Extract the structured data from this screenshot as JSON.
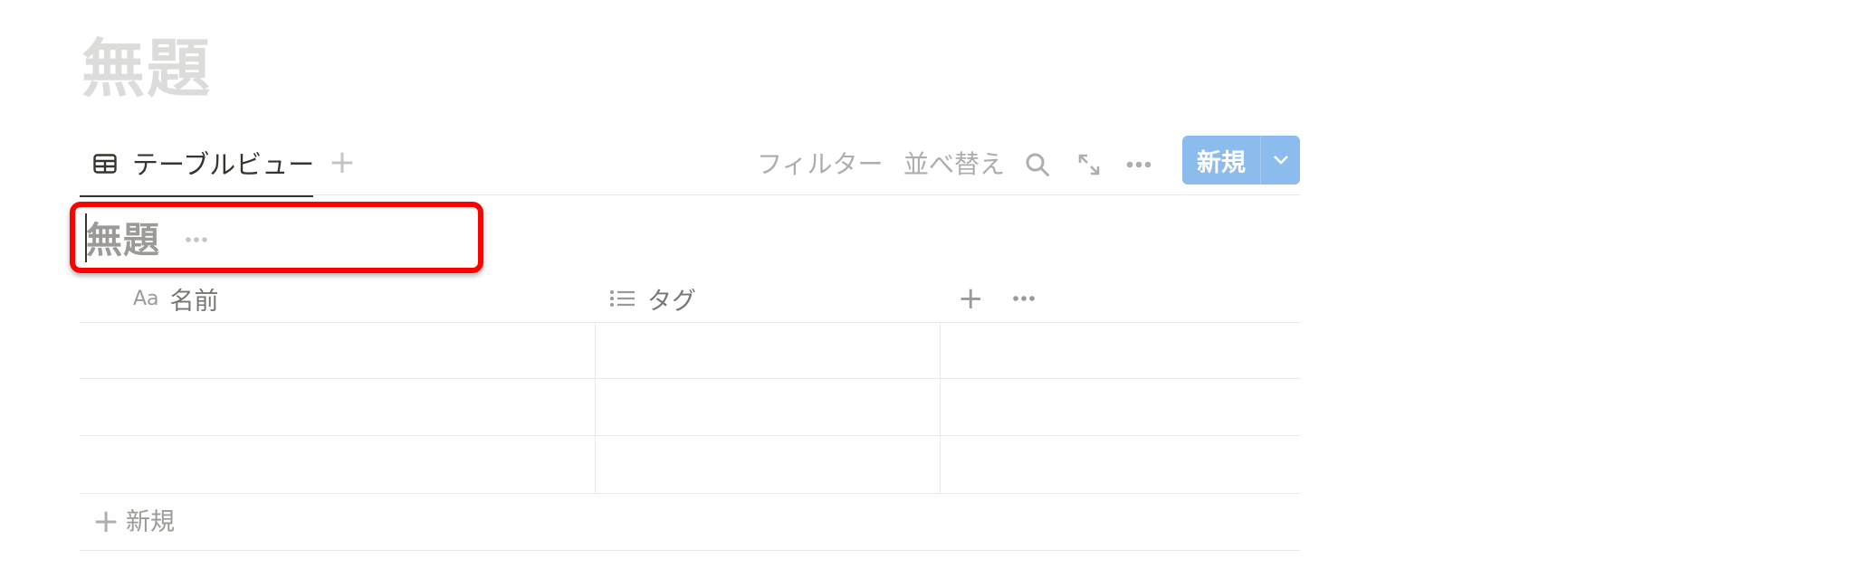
{
  "page": {
    "title": "無題"
  },
  "viewbar": {
    "tab_label": "テーブルビュー",
    "tab_icon": "table-icon",
    "add_view": "+",
    "filter_label": "フィルター",
    "sort_label": "並べ替え",
    "new_button_label": "新規"
  },
  "database": {
    "title": "無題"
  },
  "columns": [
    {
      "icon": "text-type-icon",
      "icon_text": "Aa",
      "label": "名前"
    },
    {
      "icon": "list-icon",
      "label": "タグ"
    }
  ],
  "header_add": "+",
  "rows": [
    {
      "name": "",
      "tags": ""
    },
    {
      "name": "",
      "tags": ""
    },
    {
      "name": "",
      "tags": ""
    }
  ],
  "add_row": {
    "plus": "+",
    "label": "新規"
  },
  "colors": {
    "accent": "#8cbcee",
    "highlight": "#ff0000",
    "text": "#37352f",
    "muted": "#9b9a97",
    "border": "#e9e9e7"
  }
}
